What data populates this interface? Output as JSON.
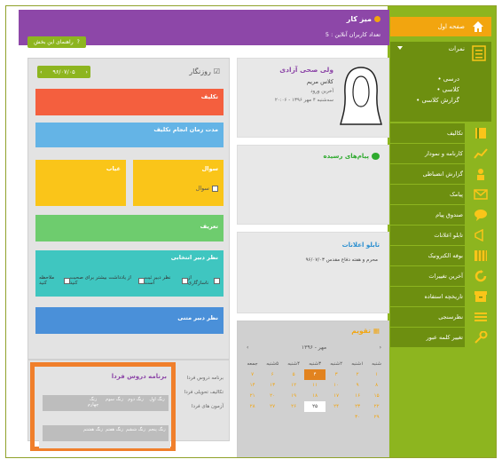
{
  "header": {
    "title": "میز کار",
    "online": "تعداد کاربران آنلاین : 5",
    "guide_label": "راهنمای این بخش"
  },
  "sidebar": {
    "home_label": "صفحه اول",
    "grades": {
      "label": "نمرات",
      "items": [
        "درسی",
        "کلاسی",
        "گزارش کلاسی"
      ]
    },
    "items": [
      {
        "label": "تکالیف",
        "icon": "book-icon"
      },
      {
        "label": "کارنامه و نمودار",
        "icon": "chart-icon"
      },
      {
        "label": "گزارش انضباطی",
        "icon": "person-icon"
      },
      {
        "label": "پیامک",
        "icon": "mail-icon"
      },
      {
        "label": "صندوق پیام",
        "icon": "chat-icon"
      },
      {
        "label": "تابلو اعلانات",
        "icon": "megaphone-icon"
      },
      {
        "label": "بوفه الکترونیک",
        "icon": "grid-icon"
      },
      {
        "label": "آخرین تغییرات",
        "icon": "refresh-icon"
      },
      {
        "label": "تاریخچه استفاده",
        "icon": "archive-icon"
      },
      {
        "label": "نظرسنجی",
        "icon": "list-icon"
      },
      {
        "label": "تغییر کلمه عبور",
        "icon": "key-icon"
      }
    ]
  },
  "profile": {
    "name": "ولی صحی آزادی",
    "class": "کلاس مریم",
    "last_login_label": "آخرین ورود",
    "last_login": "سه‌شنبه ۴ مهر ۱۳۹۶ - ۲۰:۰۶"
  },
  "messages": {
    "title": "پیام‌های رسیده"
  },
  "board": {
    "title": "تابلو اعلانات",
    "item": "محرم و هفته دفاع مقدس ۹۶/۰۷/۰۳"
  },
  "calendar": {
    "title": "تقویم",
    "month": "مهر - ۱۳۹۶",
    "weekdays": [
      "شنبه",
      "۱شنبه",
      "۲شنبه",
      "۳شنبه",
      "۴شنبه",
      "۵شنبه",
      "جمعه"
    ],
    "weeks": [
      [
        "۱",
        "۲",
        "۳",
        "۴",
        "۵",
        "۶",
        "۷"
      ],
      [
        "۸",
        "۹",
        "۱۰",
        "۱۱",
        "۱۲",
        "۱۳",
        "۱۴"
      ],
      [
        "۱۵",
        "۱۶",
        "۱۷",
        "۱۸",
        "۱۹",
        "۲۰",
        "۲۱"
      ],
      [
        "۲۲",
        "۲۳",
        "۲۴",
        "۲۵",
        "۲۶",
        "۲۷",
        "۲۸"
      ],
      [
        "۲۹",
        "۳۰",
        "",
        "",
        "",
        "",
        ""
      ]
    ],
    "today": "۴",
    "selected": "۲۵"
  },
  "diary": {
    "title": "روزنگار",
    "date": "۹۶/۰۷/۰۵",
    "homework": "تکلیف",
    "deadline": "مدت زمان انجام تکلیف",
    "question": "سوال",
    "question_cb": "سوال",
    "absence": "غیاب",
    "intro": "تعریف",
    "opinion": "نظر دبیر انتخابی",
    "opinion_opts": [
      "ملاحظه کنید",
      "از یادداشت بیشتر برای صحبت کنید",
      "نظر دبیر ثبت است",
      "از ناسازگاری"
    ],
    "text_opinion": "نظر دبیر متنی"
  },
  "schedule": {
    "title": "برنامه دروس فردا",
    "links": [
      "برنامه دروس فردا",
      "تکالیف تحویلی فردا",
      "آزمون های فردا"
    ],
    "row1": [
      "زنگ اول",
      "زنگ دوم",
      "زنگ سوم",
      "زنگ چهارم"
    ],
    "row2": [
      "زنگ پنجم",
      "زنگ ششم",
      "زنگ هفتم",
      "زنگ هشتم"
    ]
  }
}
